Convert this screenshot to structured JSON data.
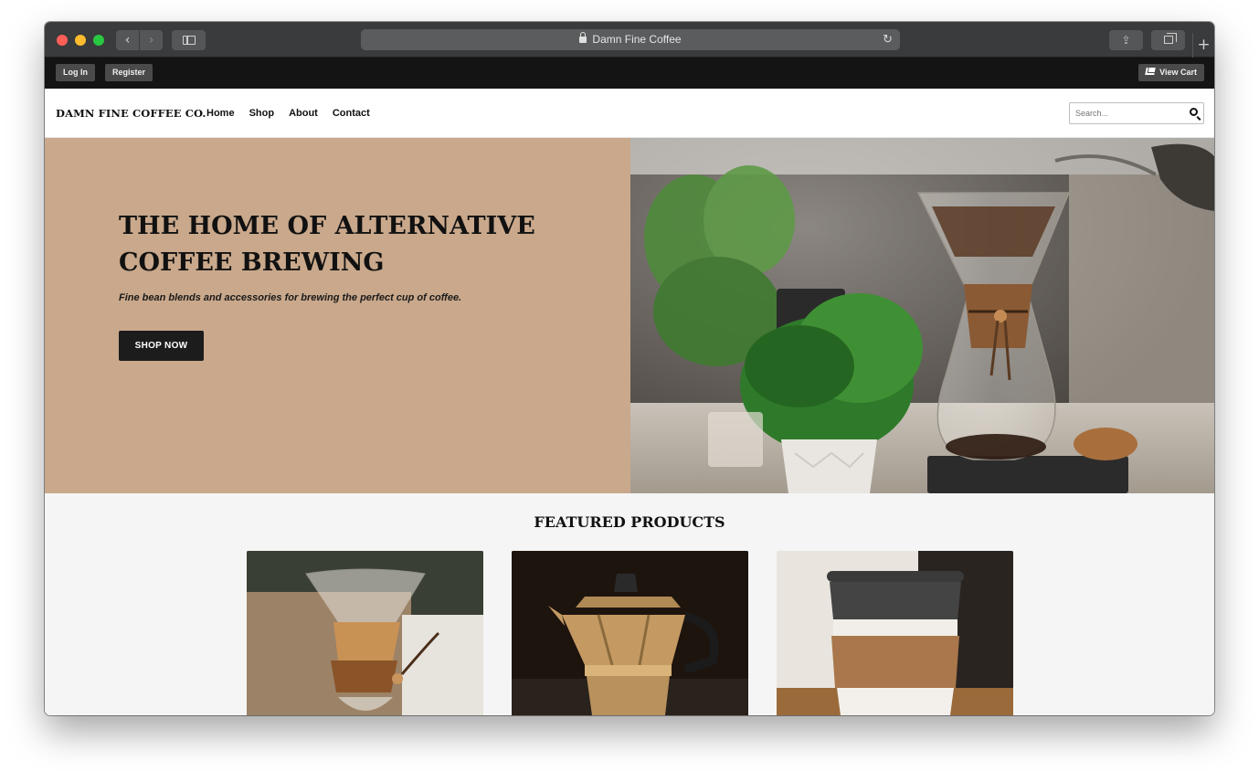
{
  "browser": {
    "url_title": "Damn Fine Coffee",
    "back_glyph": "‹",
    "forward_glyph": "›",
    "reload_glyph": "↻",
    "share_glyph": "⇪",
    "new_tab_glyph": "+"
  },
  "topbar": {
    "login_label": "Log In",
    "register_label": "Register",
    "cart_label": "View Cart"
  },
  "nav": {
    "brand": "DAMN FINE COFFEE CO.",
    "items": [
      "Home",
      "Shop",
      "About",
      "Contact"
    ],
    "search_placeholder": "Search..."
  },
  "hero": {
    "title": "THE HOME OF ALTERNATIVE COFFEE BREWING",
    "subtitle": "Fine bean blends and accessories for brewing the perfect cup of coffee.",
    "cta_label": "SHOP NOW",
    "background_color": "#c9a88b"
  },
  "featured": {
    "heading": "FEATURED PRODUCTS",
    "products": [
      {
        "image": "chemex-pour-over"
      },
      {
        "image": "moka-pot"
      },
      {
        "image": "reusable-cup"
      }
    ]
  }
}
